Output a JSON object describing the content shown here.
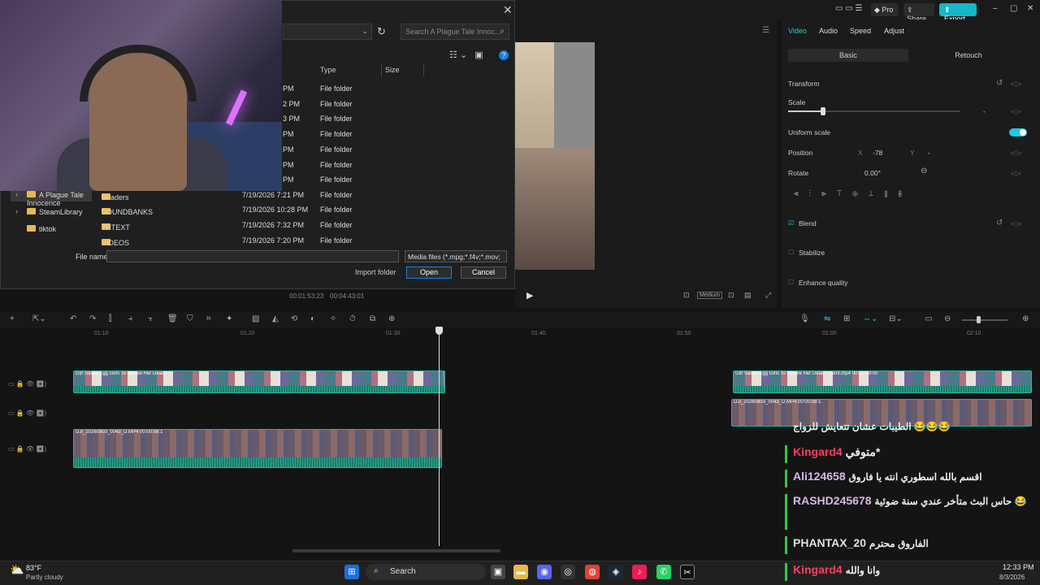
{
  "app": {
    "pro_label": "Pro",
    "share_label": "Share",
    "export_label": "Export"
  },
  "dialog": {
    "search_placeholder": "Search A Plague Tale Innoc...",
    "col_type": "Type",
    "col_size": "Size",
    "top_rows": [
      {
        "time": "PM",
        "type": "File folder"
      },
      {
        "time": "2 PM",
        "type": "File folder"
      },
      {
        "time": "3 PM",
        "type": "File folder"
      },
      {
        "time": "PM",
        "type": "File folder"
      },
      {
        "time": "PM",
        "type": "File folder"
      },
      {
        "time": "PM",
        "type": "File folder"
      },
      {
        "time": "PM",
        "type": "File folder"
      }
    ],
    "nav": [
      {
        "label": "A Plague Tale Innocence"
      },
      {
        "label": "SteamLibrary"
      },
      {
        "label": "tiktok"
      }
    ],
    "files": [
      {
        "name": "Shaders",
        "date": "7/19/2026 7:21 PM",
        "type": "File folder"
      },
      {
        "name": "SOUNDBANKS",
        "date": "7/19/2026 10:28 PM",
        "type": "File folder"
      },
      {
        "name": "TRTEXT",
        "date": "7/19/2026 7:32 PM",
        "type": "File folder"
      },
      {
        "name": "VIDEOS",
        "date": "7/19/2026 7:20 PM",
        "type": "File folder"
      }
    ],
    "file_name_label": "File name:",
    "file_type": "Media files (*.mpg;*.f4v;*.mov;",
    "import_folder": "Import folder",
    "open": "Open",
    "cancel": "Cancel"
  },
  "preview": {
    "current_time": "00:01:53:23",
    "total_time": "00:04:43:01",
    "quality": "Medium"
  },
  "panel": {
    "tabs": [
      "Video",
      "Audio",
      "Speed",
      "Adjust"
    ],
    "subtabs": [
      "Basic",
      "Retouch"
    ],
    "transform": "Transform",
    "scale": "Scale",
    "scale_value": "-",
    "uniform_scale": "Uniform scale",
    "position": "Position",
    "pos_x_label": "X",
    "pos_x": "-78",
    "pos_y_label": "Y",
    "pos_y": "-",
    "rotate": "Rotate",
    "rotate_value": "0.00°",
    "blend": "Blend",
    "stabilize": "Stabilize",
    "enhance_quality": "Enhance quality"
  },
  "timeline": {
    "ruler": [
      "01:10",
      "01:20",
      "01:30",
      "01:40",
      "01:50",
      "02:00",
      "02:10"
    ],
    "clip_title": "Girl Saves Egg Girls To Revive Her Dead I",
    "clip_right_title": "Girl Saves Egg Girls To Revive Her Dead I ssent.mp4   00:02:49:00",
    "clip_v2_title": "DJI_20260803_0043_D.MP4   00:00:08:1"
  },
  "chat": [
    {
      "user": "",
      "msg": "الطيبات عشان تتعايش للزواج 😂😂😂"
    },
    {
      "user": "Kingard4",
      "msg": "متوفي*"
    },
    {
      "user": "Ali124658",
      "msg": "اقسم بالله اسطوري انته يا فاروق"
    },
    {
      "user": "RASHD245678",
      "msg": "حاس البث متأخر عندي سنة ضوئية 😂"
    },
    {
      "user": "PHANTAX_20",
      "msg": "الفاروق محترم"
    },
    {
      "user": "Kingard4",
      "msg": "وانا والله"
    }
  ],
  "taskbar": {
    "temp": "83°F",
    "weather": "Partly cloudy",
    "search": "Search",
    "time": "12:33 PM",
    "date": "8/3/2026"
  }
}
